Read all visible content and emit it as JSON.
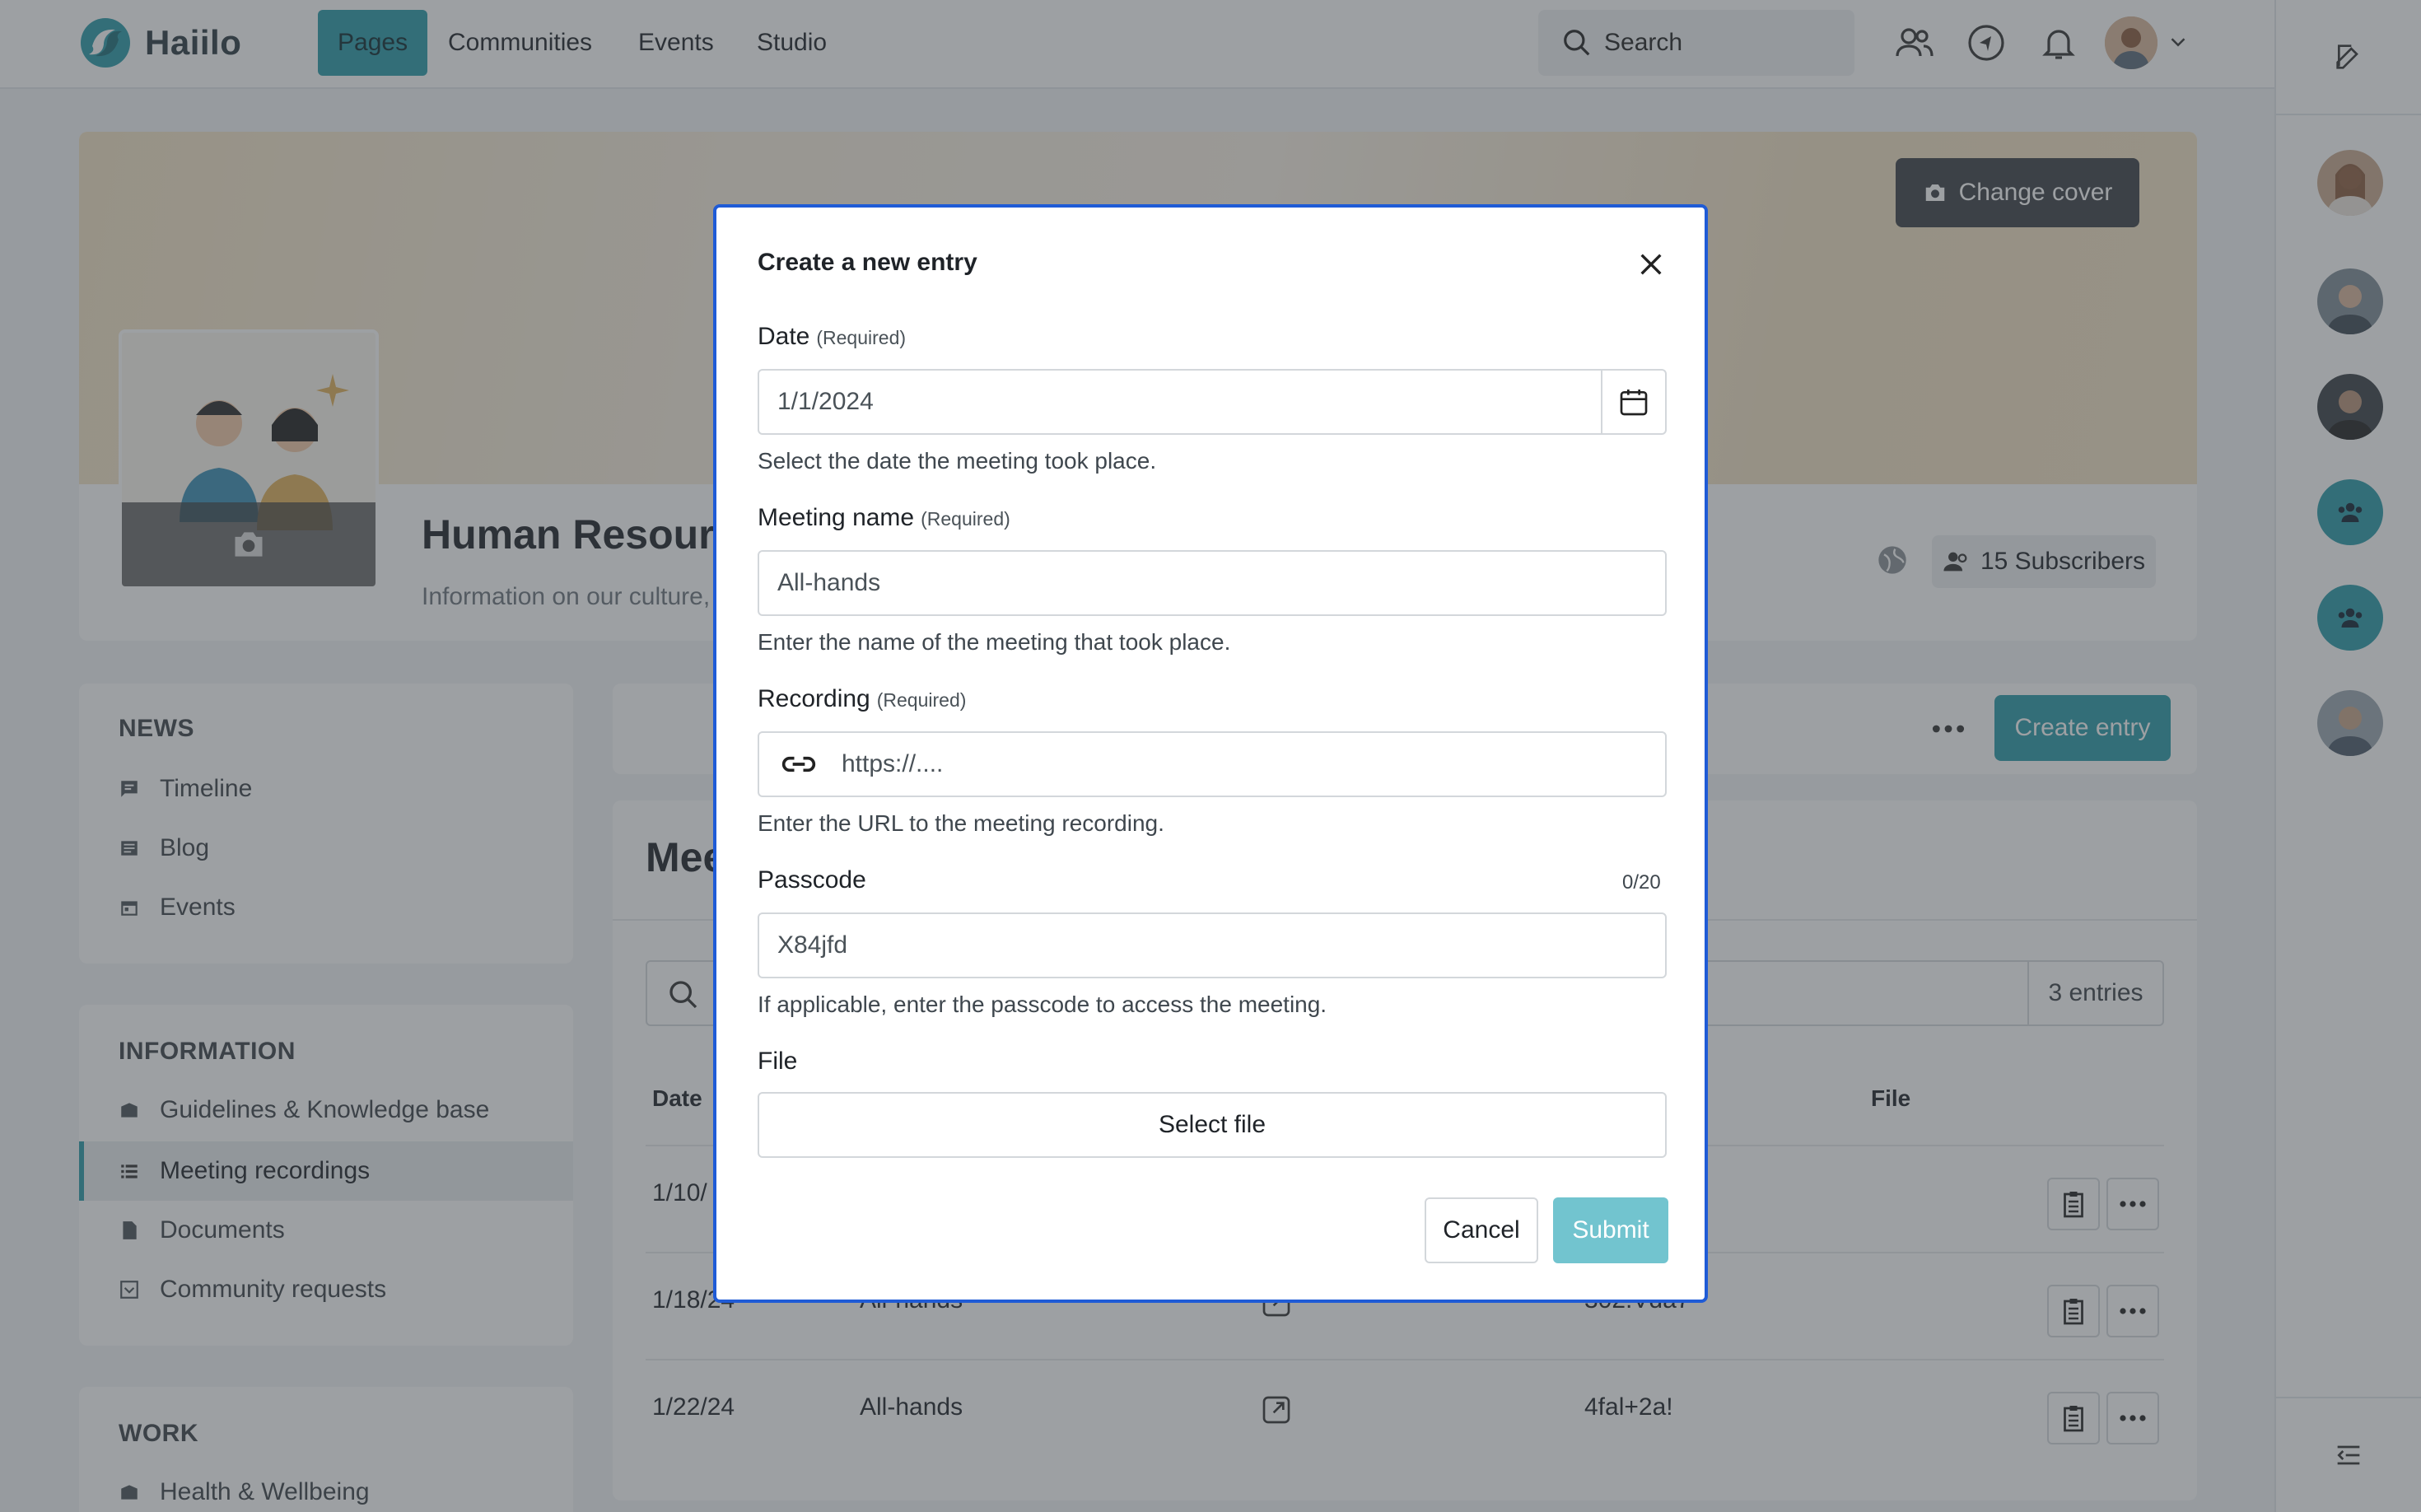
{
  "brand": {
    "name": "Haiilo",
    "accent": "#2b9aa8",
    "focus": "#1f5bd6"
  },
  "topnav": {
    "items": [
      {
        "label": "Pages",
        "active": true
      },
      {
        "label": "Communities",
        "active": false
      },
      {
        "label": "Events",
        "active": false
      },
      {
        "label": "Studio",
        "active": false
      }
    ],
    "search_label": "Search",
    "icons": [
      "people-icon",
      "compass-icon",
      "bell-icon",
      "avatar",
      "chevron-down-icon"
    ]
  },
  "rail": {
    "top_icon": "edit-icon",
    "bottom_icon": "collapse-icon",
    "avatars": [
      "avatar-woman",
      "avatar-man-glasses",
      "avatar-man",
      "group-icon",
      "group-icon",
      "avatar-man-beard"
    ]
  },
  "cover": {
    "change_cover_label": "Change cover",
    "page_title": "Human Resource",
    "page_subtitle": "Information on our culture,",
    "subscribers_label": "15 Subscribers"
  },
  "sidebar": {
    "news": {
      "heading": "NEWS",
      "items": [
        {
          "label": "Timeline",
          "icon": "timeline-icon"
        },
        {
          "label": "Blog",
          "icon": "blog-icon"
        },
        {
          "label": "Events",
          "icon": "calendar-icon"
        }
      ]
    },
    "information": {
      "heading": "INFORMATION",
      "items": [
        {
          "label": "Guidelines & Knowledge base",
          "icon": "book-icon",
          "active": false
        },
        {
          "label": "Meeting recordings",
          "icon": "list-icon",
          "active": true
        },
        {
          "label": "Documents",
          "icon": "document-icon",
          "active": false
        },
        {
          "label": "Community requests",
          "icon": "inbox-icon",
          "active": false
        }
      ]
    },
    "work": {
      "heading": "WORK",
      "items": [
        {
          "label": "Health & Wellbeing",
          "icon": "book-icon"
        }
      ]
    }
  },
  "main": {
    "create_entry_label": "Create entry",
    "title": "Mee",
    "entries_count": "3 entries",
    "columns": {
      "date": "Date",
      "file": "File"
    },
    "rows": [
      {
        "date": "1/10/",
        "name": "",
        "passcode": ""
      },
      {
        "date": "1/18/24",
        "name": "All-hands",
        "passcode": "302.Vda7"
      },
      {
        "date": "1/22/24",
        "name": "All-hands",
        "passcode": "4fal+2a!"
      }
    ]
  },
  "modal": {
    "title": "Create a new entry",
    "required_tag": "(Required)",
    "date": {
      "label": "Date",
      "value": "1/1/2024",
      "help": "Select the date the meeting took place."
    },
    "meeting_name": {
      "label": "Meeting name",
      "value": "All-hands",
      "help": "Enter the name of the meeting that took place."
    },
    "recording": {
      "label": "Recording",
      "placeholder": "https://....",
      "help": "Enter the URL to the meeting recording."
    },
    "passcode": {
      "label": "Passcode",
      "counter": "0/20",
      "placeholder": "X84jfd",
      "help": "If applicable, enter the passcode to access the meeting."
    },
    "file": {
      "label": "File",
      "button": "Select file"
    },
    "cancel_label": "Cancel",
    "submit_label": "Submit"
  }
}
